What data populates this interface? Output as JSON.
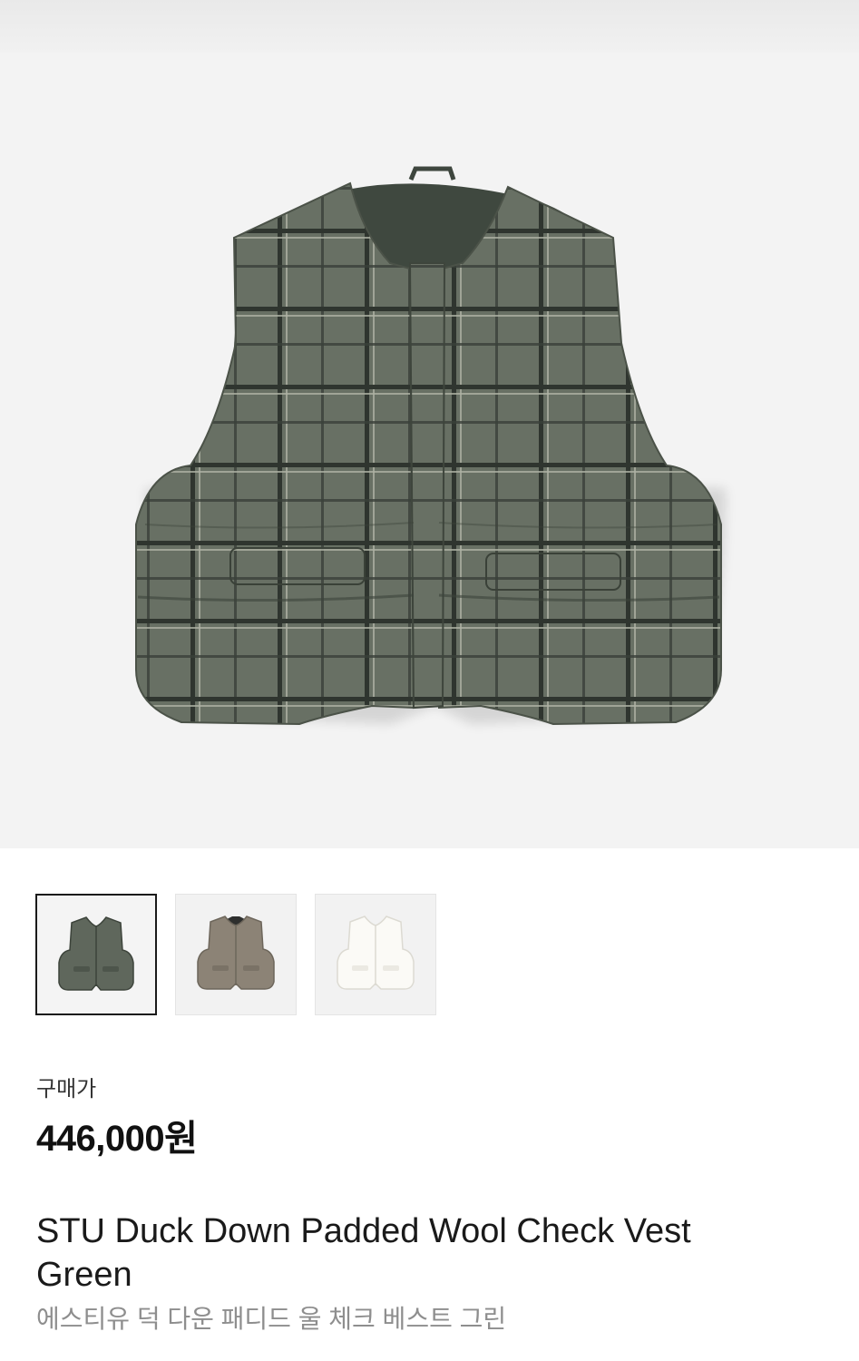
{
  "product": {
    "main_image_icon": "vest-image",
    "thumbnails": [
      {
        "color_name": "green",
        "fill": "#5f675c",
        "selected": true
      },
      {
        "color_name": "beige",
        "fill": "#8c8376",
        "selected": false
      },
      {
        "color_name": "ivory",
        "fill": "#f4f3ef",
        "selected": false
      }
    ],
    "price_label": "구매가",
    "price": "446,000원",
    "name_en": "STU Duck Down Padded Wool Check Vest Green",
    "name_ko": "에스티유 덕 다운 패디드 울 체크 베스트 그린"
  },
  "colors": {
    "vest_green": "#626a5f",
    "lining_green": "#3f483f",
    "check_dark": "#2e332d",
    "check_light": "#a9ad9f"
  }
}
